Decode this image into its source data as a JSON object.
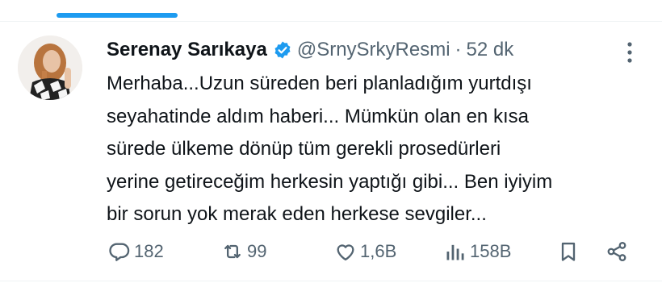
{
  "tweet": {
    "display_name": "Serenay Sarıkaya",
    "handle": "@SrnySrkyResmi",
    "separator": "·",
    "time": "52 dk",
    "verified_icon": "verified-badge-icon",
    "text": "Merhaba...Uzun süreden beri planladığım yurtdışı\nseyahatinde aldım haberi... Mümkün olan en kısa\nsürede ülkeme dönüp tüm gerekli prosedürleri\nyerine getireceğim herkesin yaptığı gibi... Ben iyiyim\nbir sorun yok merak eden herkese sevgiler..."
  },
  "actions": {
    "reply": {
      "icon": "reply-icon",
      "count": "182"
    },
    "retweet": {
      "icon": "retweet-icon",
      "count": "99"
    },
    "like": {
      "icon": "heart-icon",
      "count": "1,6B"
    },
    "views": {
      "icon": "analytics-icon",
      "count": "158B"
    },
    "bookmark": {
      "icon": "bookmark-icon"
    },
    "share": {
      "icon": "share-icon"
    }
  },
  "colors": {
    "accent": "#1d9bf0",
    "text": "#0f1419",
    "muted": "#536471",
    "divider": "#eff3f4"
  }
}
